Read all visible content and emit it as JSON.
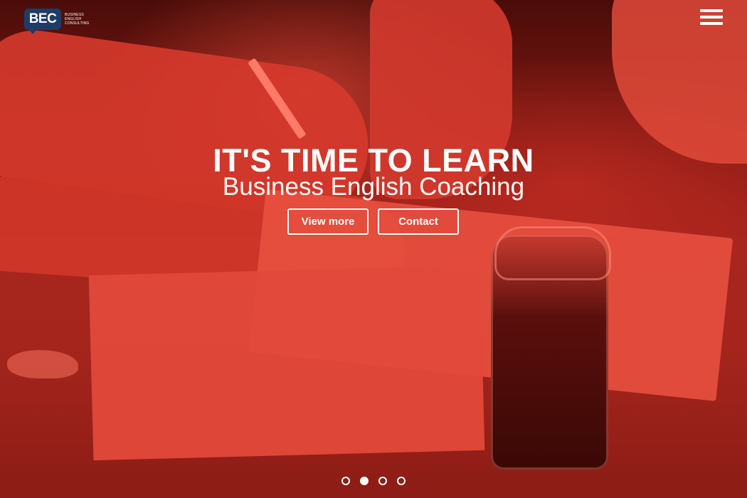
{
  "logo": {
    "mark": "BEC",
    "lines": [
      "BUSINESS",
      "ENGLISH",
      "CONSULTING"
    ]
  },
  "nav": {
    "icon": "hamburger-menu-icon"
  },
  "hero": {
    "title": "IT'S TIME TO LEARN",
    "subtitle": "Business English Coaching",
    "buttons": {
      "view_more": "View more",
      "contact": "Contact"
    },
    "overlay_color": "#c8302a"
  },
  "carousel": {
    "slides": 4,
    "active_index": 2
  }
}
